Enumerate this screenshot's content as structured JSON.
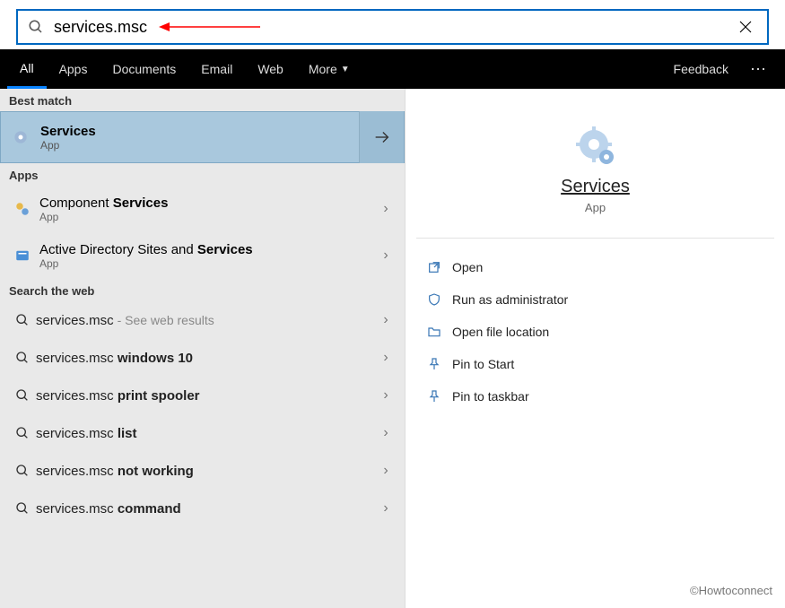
{
  "search": {
    "query": "services.msc",
    "clear_icon": "close-icon"
  },
  "tabs": {
    "items": [
      "All",
      "Apps",
      "Documents",
      "Email",
      "Web"
    ],
    "more": "More",
    "active_index": 0,
    "feedback": "Feedback"
  },
  "sections": {
    "best_match": "Best match",
    "apps": "Apps",
    "web": "Search the web"
  },
  "best": {
    "title": "Services",
    "subtitle": "App"
  },
  "apps": [
    {
      "prefix": "Component ",
      "bold": "Services",
      "suffix": "",
      "subtitle": "App"
    },
    {
      "prefix": "Active Directory Sites and ",
      "bold": "Services",
      "suffix": "",
      "subtitle": "App"
    }
  ],
  "web": [
    {
      "text": "services.msc",
      "hint": " - See web results",
      "bold": ""
    },
    {
      "text": "services.msc ",
      "hint": "",
      "bold": "windows 10"
    },
    {
      "text": "services.msc ",
      "hint": "",
      "bold": "print spooler"
    },
    {
      "text": "services.msc ",
      "hint": "",
      "bold": "list"
    },
    {
      "text": "services.msc ",
      "hint": "",
      "bold": "not working"
    },
    {
      "text": "services.msc ",
      "hint": "",
      "bold": "command"
    }
  ],
  "preview": {
    "title": "Services",
    "subtitle": "App",
    "actions": [
      {
        "icon": "open-icon",
        "label": "Open"
      },
      {
        "icon": "admin-icon",
        "label": "Run as administrator"
      },
      {
        "icon": "folder-icon",
        "label": "Open file location"
      },
      {
        "icon": "pin-start-icon",
        "label": "Pin to Start"
      },
      {
        "icon": "pin-taskbar-icon",
        "label": "Pin to taskbar"
      }
    ]
  },
  "footer": "©Howtoconnect"
}
